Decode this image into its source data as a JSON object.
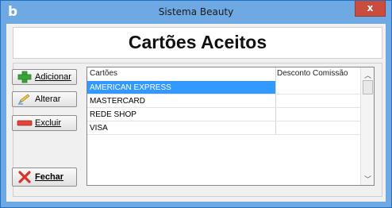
{
  "window": {
    "title": "Sistema Beauty",
    "app_icon": "b",
    "close_label": "x"
  },
  "header": {
    "title": "Cartões Aceitos"
  },
  "toolbar": {
    "add": {
      "label": "Adicionar",
      "icon": "plus-icon"
    },
    "edit": {
      "label": "Alterar",
      "icon": "pencil-icon"
    },
    "delete": {
      "label": "Excluir",
      "icon": "minus-icon"
    },
    "close": {
      "label": "Fechar",
      "icon": "x-icon"
    }
  },
  "grid": {
    "columns": [
      "Cartões",
      "Desconto Comissão"
    ],
    "rows": [
      {
        "name": "AMERICAN EXPRESS",
        "discount": "",
        "selected": true
      },
      {
        "name": "MASTERCARD",
        "discount": ""
      },
      {
        "name": "REDE SHOP",
        "discount": ""
      },
      {
        "name": "VISA",
        "discount": ""
      }
    ]
  },
  "colors": {
    "titlebar": "#6ea9e3",
    "close": "#c94c3c",
    "selection": "#3399ff"
  }
}
